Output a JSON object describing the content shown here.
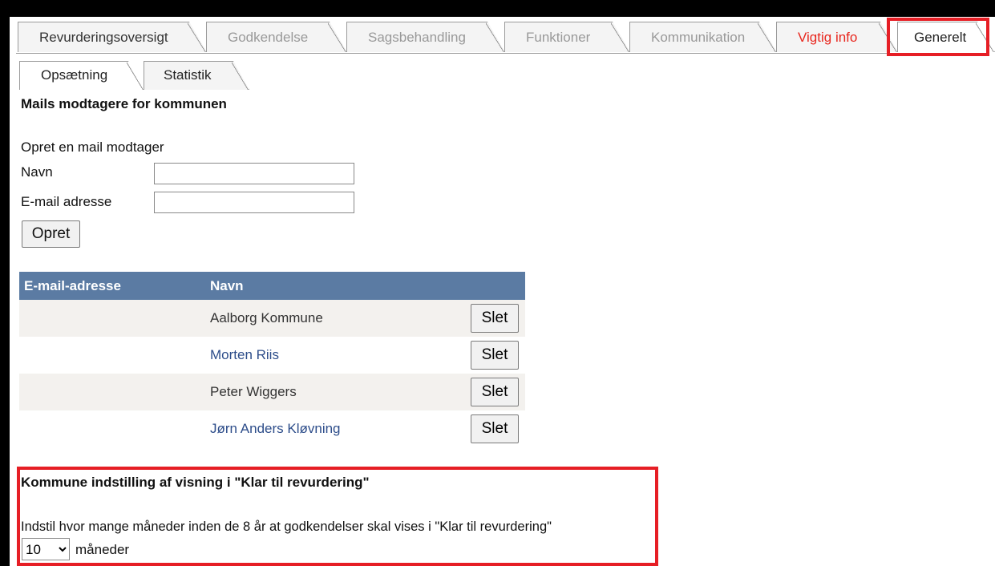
{
  "main_tabs": [
    {
      "label": "Revurderingsoversigt"
    },
    {
      "label": "Godkendelse"
    },
    {
      "label": "Sagsbehandling"
    },
    {
      "label": "Funktioner"
    },
    {
      "label": "Kommunikation"
    },
    {
      "label": "Vigtig info"
    },
    {
      "label": "Generelt"
    }
  ],
  "sub_tabs": [
    {
      "label": "Opsætning"
    },
    {
      "label": "Statistik"
    }
  ],
  "section_title": "Mails modtagere for kommunen",
  "create_form": {
    "title": "Opret en mail modtager",
    "name_label": "Navn",
    "name_value": "",
    "email_label": "E-mail adresse",
    "email_value": "",
    "submit_label": "Opret"
  },
  "table": {
    "headers": [
      "E-mail-adresse",
      "Navn"
    ],
    "rows": [
      {
        "email": "",
        "name": "Aalborg Kommune",
        "action": "Slet"
      },
      {
        "email": "",
        "name": "Morten Riis",
        "action": "Slet"
      },
      {
        "email": "",
        "name": "Peter Wiggers",
        "action": "Slet"
      },
      {
        "email": "",
        "name": "Jørn Anders Kløvning",
        "action": "Slet"
      }
    ]
  },
  "settings": {
    "title": "Kommune indstilling af visning i \"Klar til revurdering\"",
    "description": "Indstil hvor mange måneder inden de 8 år at godkendelser skal vises i \"Klar til revurdering\"",
    "months_value": "10",
    "months_unit": "måneder"
  },
  "colors": {
    "table_header": "#5b7ba3",
    "highlight": "#e61e25",
    "vigtig_info": "#e8271e",
    "link": "#2d4d8a"
  }
}
